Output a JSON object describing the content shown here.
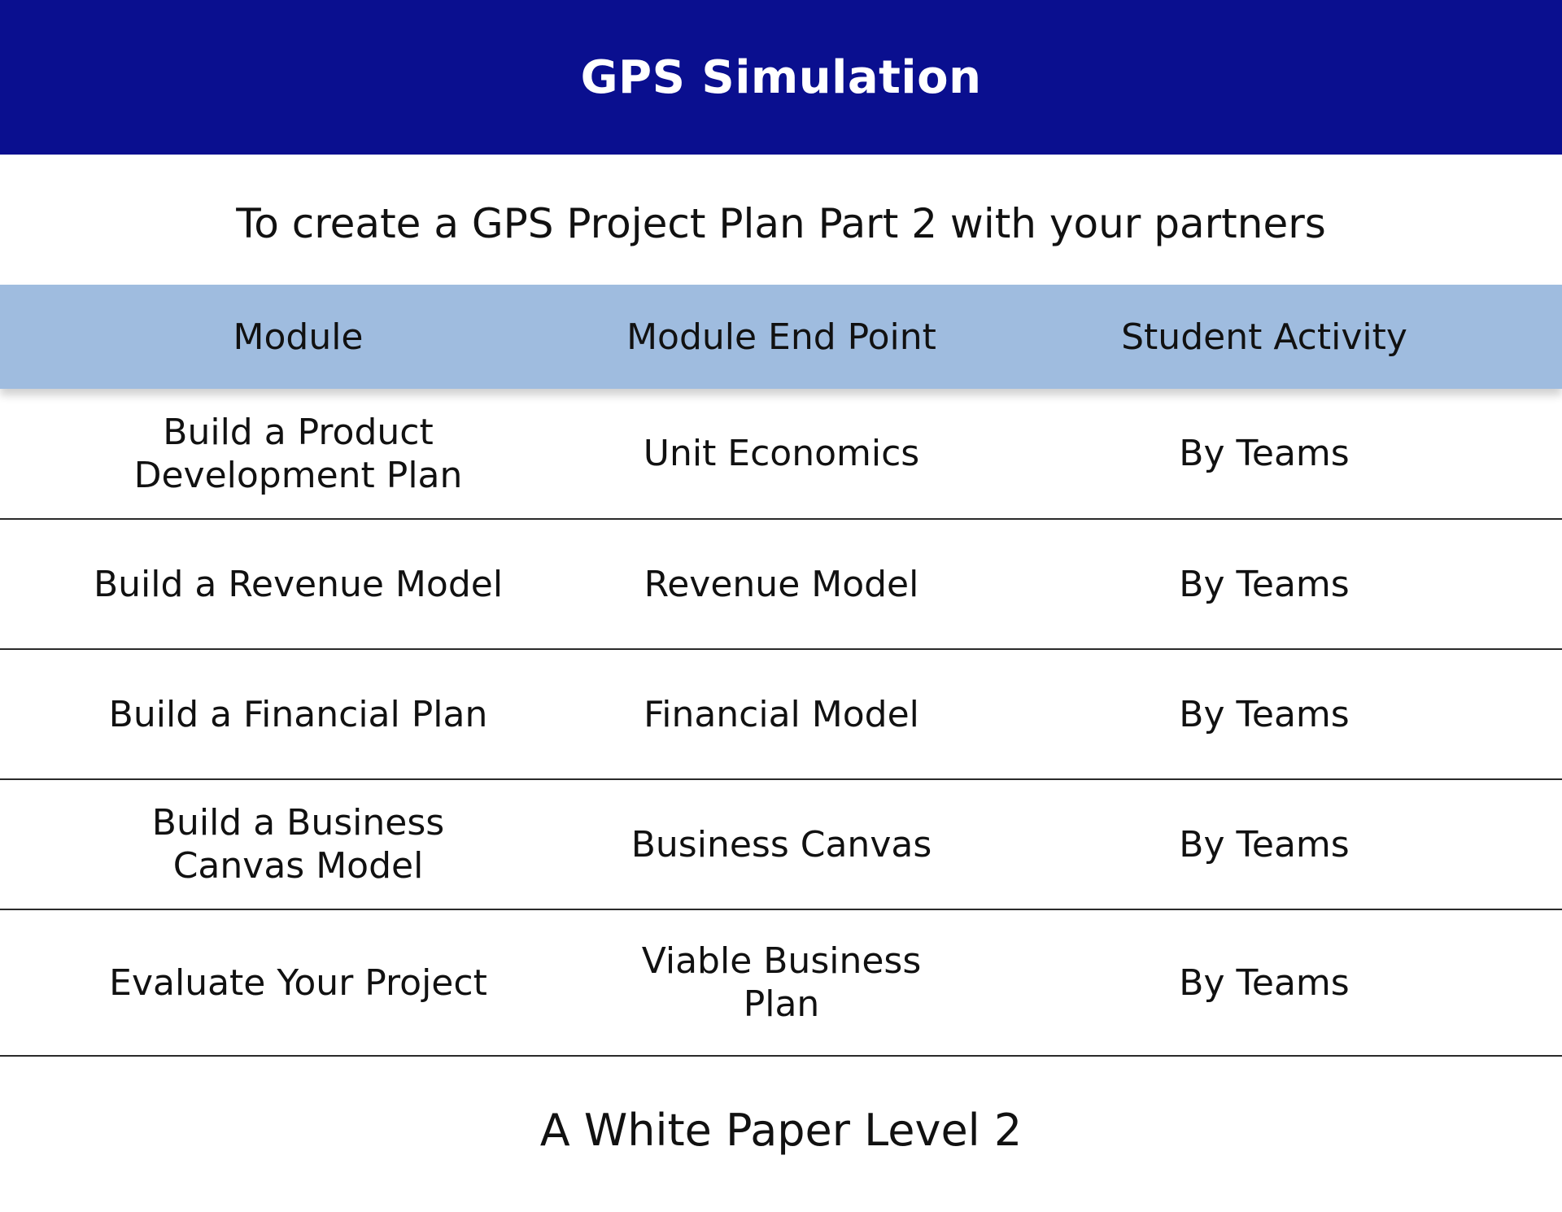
{
  "banner": {
    "title": "GPS Simulation",
    "background": "#0a0f8f"
  },
  "subtitle": "To create a GPS Project Plan Part 2 with your partners",
  "table": {
    "header_color": "#9fbcdf",
    "columns": [
      "Module",
      "Module End Point",
      "Student Activity"
    ],
    "rows": [
      {
        "module": "Build a Product Development Plan",
        "end_point": "Unit Economics",
        "activity": "By Teams"
      },
      {
        "module": "Build a Revenue Model",
        "end_point": "Revenue Model",
        "activity": "By Teams"
      },
      {
        "module": "Build a Financial Plan",
        "end_point": "Financial Model",
        "activity": "By Teams"
      },
      {
        "module": "Build a Business Canvas Model",
        "end_point": "Business Canvas",
        "activity": "By Teams"
      },
      {
        "module": "Evaluate Your Project",
        "end_point": "Viable Business Plan",
        "activity": "By Teams"
      }
    ]
  },
  "footer": "A White Paper Level 2"
}
